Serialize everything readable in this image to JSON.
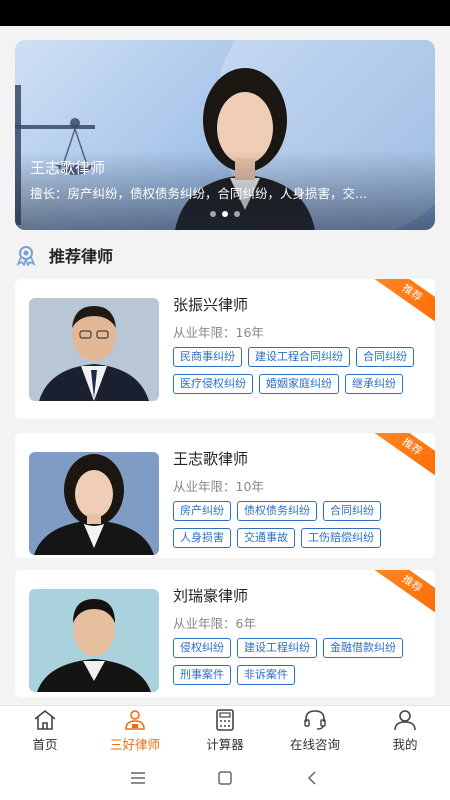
{
  "banner": {
    "title": "王志歌律师",
    "description": "擅长：房产纠纷，债权债务纠纷，合同纠纷，人身损害，交...",
    "dots": 3,
    "active_dot": 1
  },
  "section": {
    "title": "推荐律师",
    "icon": "award-ribbon-icon"
  },
  "lawyers": [
    {
      "name": "张振兴律师",
      "years": "从业年限：16年",
      "badge": "推荐",
      "tags": [
        "民商事纠纷",
        "建设工程合同纠纷",
        "合同纠纷",
        "医疗侵权纠纷",
        "婚姻家庭纠纷",
        "继承纠纷"
      ]
    },
    {
      "name": "王志歌律师",
      "years": "从业年限：10年",
      "badge": "推荐",
      "tags": [
        "房产纠纷",
        "债权债务纠纷",
        "合同纠纷",
        "人身损害",
        "交通事故",
        "工伤赔偿纠纷"
      ]
    },
    {
      "name": "刘瑞豪律师",
      "years": "从业年限：6年",
      "badge": "推荐",
      "tags": [
        "侵权纠纷",
        "建设工程纠纷",
        "金融借款纠纷",
        "刑事案件",
        "非诉案件"
      ]
    }
  ],
  "tabbar": [
    {
      "label": "首页",
      "icon": "home-icon",
      "active": false
    },
    {
      "label": "三好律师",
      "icon": "lawyer-icon",
      "active": true
    },
    {
      "label": "计算器",
      "icon": "calculator-icon",
      "active": false
    },
    {
      "label": "在线咨询",
      "icon": "headset-icon",
      "active": false
    },
    {
      "label": "我的",
      "icon": "user-icon",
      "active": false
    }
  ],
  "colors": {
    "accent": "#f26a10",
    "tag": "#2c6fc4",
    "badge": "#ff7a1a"
  }
}
